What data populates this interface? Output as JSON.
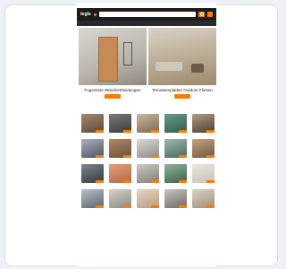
{
  "topbar": {
    "items": [
      "",
      "",
      "",
      ""
    ]
  },
  "header": {
    "logo": "tegls",
    "search_placeholder": ""
  },
  "nav": {
    "items": [
      "",
      "",
      "",
      "",
      "",
      "",
      "",
      "",
      ""
    ]
  },
  "promos": [
    {
      "title": "Fugenlose Wandverkleidungen",
      "subtitle": "",
      "button": ""
    },
    {
      "title": "Terrassenplatten Outdoor Fliesen",
      "subtitle": "",
      "button": ""
    }
  ],
  "section_title": "",
  "products": [
    {
      "color": "#5a4a3c",
      "color2": "#a58a6a"
    },
    {
      "color": "#3b3b3b",
      "color2": "#7a7a7a"
    },
    {
      "color": "#7c6a55",
      "color2": "#c8b89c"
    },
    {
      "color": "#2f5b4f",
      "color2": "#6b9b8a"
    },
    {
      "color": "#4a3f36",
      "color2": "#b39b7e"
    },
    {
      "color": "#4d5561",
      "color2": "#aab1bb"
    },
    {
      "color": "#6a4f3a",
      "color2": "#b08a63"
    },
    {
      "color": "#8d8d89",
      "color2": "#d9d8d2"
    },
    {
      "color": "#4a6a5e",
      "color2": "#9fb8ae"
    },
    {
      "color": "#6b5744",
      "color2": "#c8a37b"
    },
    {
      "color": "#353a40",
      "color2": "#7e858e"
    },
    {
      "color": "#b06a47",
      "color2": "#e0a07a"
    },
    {
      "color": "#7f7f7a",
      "color2": "#cfcac0"
    },
    {
      "color": "#3d5f4c",
      "color2": "#8fb59c"
    },
    {
      "color": "#c9c4b8",
      "color2": "#e8e5de"
    },
    {
      "color": "#5c6670",
      "color2": "#b8c0c8"
    },
    {
      "color": "#8d8880",
      "color2": "#d6d2c9"
    },
    {
      "color": "#b89a7e",
      "color2": "#e6d6c4"
    },
    {
      "color": "#6e6a64",
      "color2": "#c9c5bd"
    },
    {
      "color": "#9c8e7c",
      "color2": "#ddd3c4"
    }
  ],
  "colors": {
    "accent": "#ff7a00",
    "header": "#1c1c1c",
    "nav": "#2b2b2b"
  }
}
